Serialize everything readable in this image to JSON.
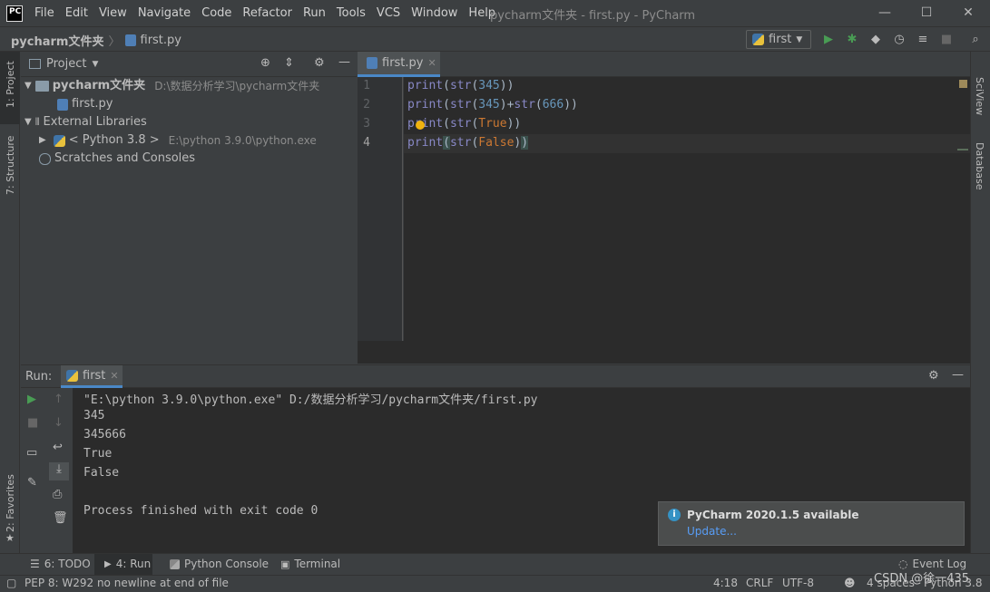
{
  "window": {
    "app_icon": "PC",
    "title": "pycharm文件夹 - first.py - PyCharm",
    "menu": [
      "File",
      "Edit",
      "View",
      "Navigate",
      "Code",
      "Refactor",
      "Run",
      "Tools",
      "VCS",
      "Window",
      "Help"
    ],
    "controls": {
      "minimize": "—",
      "maximize": "☐",
      "close": "✕"
    }
  },
  "navbar": {
    "project": "pycharm文件夹",
    "file": "first.py",
    "run_config": "first"
  },
  "left_stripe": {
    "project_tab": "1: Project",
    "structure_tab": "7: Structure",
    "favorites_tab": "2: Favorites"
  },
  "right_stripe": {
    "sciview_tab": "SciView",
    "database_tab": "Database"
  },
  "project_panel": {
    "title": "Project",
    "root": {
      "name": "pycharm文件夹",
      "path": "D:\\数据分析学习\\pycharm文件夹"
    },
    "file": "first.py",
    "external_libraries": "External Libraries",
    "python_sdk": {
      "name": "< Python 3.8 >",
      "path": "E:\\python 3.9.0\\python.exe"
    },
    "scratches": "Scratches and Consoles"
  },
  "editor": {
    "tab": "first.py",
    "line_numbers": [
      "1",
      "2",
      "3",
      "4"
    ]
  },
  "run_panel": {
    "label": "Run:",
    "tab": "first",
    "output": [
      "\"E:\\python 3.9.0\\python.exe\" D:/数据分析学习/pycharm文件夹/first.py",
      "345",
      "345666",
      "True",
      "False",
      "",
      "Process finished with exit code 0"
    ]
  },
  "notification": {
    "title": "PyCharm 2020.1.5 available",
    "link": "Update..."
  },
  "bottom_tabs": {
    "todo": "6: TODO",
    "run": "4: Run",
    "python_console": "Python Console",
    "terminal": "Terminal",
    "event_log": "Event Log"
  },
  "status_bar": {
    "message": "PEP 8: W292 no newline at end of file",
    "position": "4:18",
    "line_sep": "CRLF",
    "encoding": "UTF-8",
    "indent": "4 spaces",
    "interpreter": "Python 3.8",
    "watermark": "CSDN @徐一435"
  },
  "colors": {
    "accent": "#4a88c7",
    "run_green": "#499c54",
    "keyword": "#8888c6",
    "number": "#6897bb",
    "constant": "#cc7832",
    "link": "#589df6"
  }
}
